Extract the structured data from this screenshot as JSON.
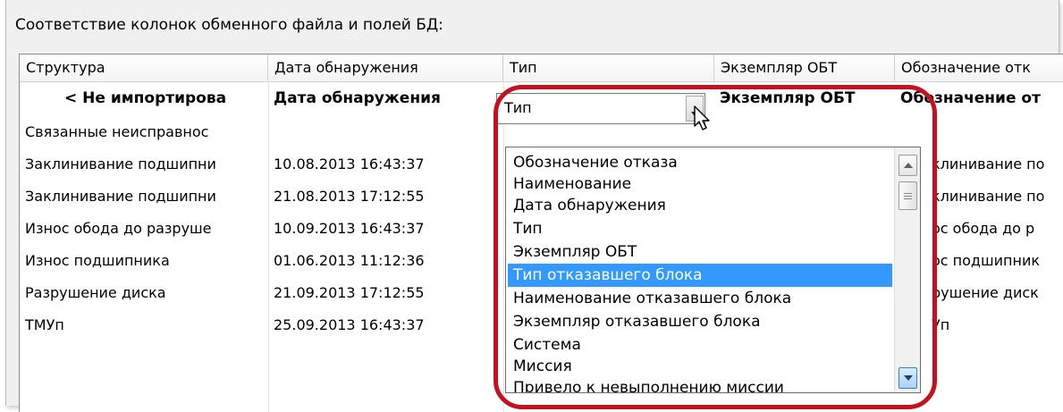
{
  "caption": "Соответствие колонок обменного файла и полей БД:",
  "columns": [
    "Структура",
    "Дата обнаружения",
    "Тип",
    "Экземпляр ОБТ",
    "Обозначение отк"
  ],
  "mapping_row": [
    "< Не импортирова",
    "Дата обнаружения",
    "",
    "Экземпляр ОБТ",
    "Обозначение от"
  ],
  "editor_value": "Тип",
  "rows": [
    [
      "Связанные неисправнос",
      "",
      "",
      "",
      ""
    ],
    [
      "Заклинивание подшипни",
      "10.08.2013 16:43:37",
      "",
      "",
      "клинивание по"
    ],
    [
      "Заклинивание подшипни",
      "21.08.2013 17:12:55",
      "",
      "",
      "клинивание по"
    ],
    [
      "Износ обода до разруше",
      "10.09.2013 16:43:37",
      "",
      "",
      "ос обода до р"
    ],
    [
      "Износ подшипника",
      "01.06.2013 11:12:36",
      "",
      "",
      "ос подшипник"
    ],
    [
      "Разрушение диска",
      "21.09.2013 17:12:55",
      "",
      "",
      "рушение диск"
    ],
    [
      "ТМУп",
      "25.09.2013 16:43:37",
      "",
      "",
      "Уп"
    ]
  ],
  "dropdown_options": [
    "Обозначение отказа",
    "Наименование",
    "Дата обнаружения",
    "Тип",
    "Экземпляр ОБТ",
    "Тип отказавшего блока",
    "Наименование отказавшего блока",
    "Экземпляр отказавшего блока",
    "Система",
    "Миссия",
    "Привело к невыполнению миссии"
  ],
  "selected_option": "Тип отказавшего блока",
  "colors": {
    "selection": "#3399ff",
    "highlight_ring": "#c4101f"
  }
}
